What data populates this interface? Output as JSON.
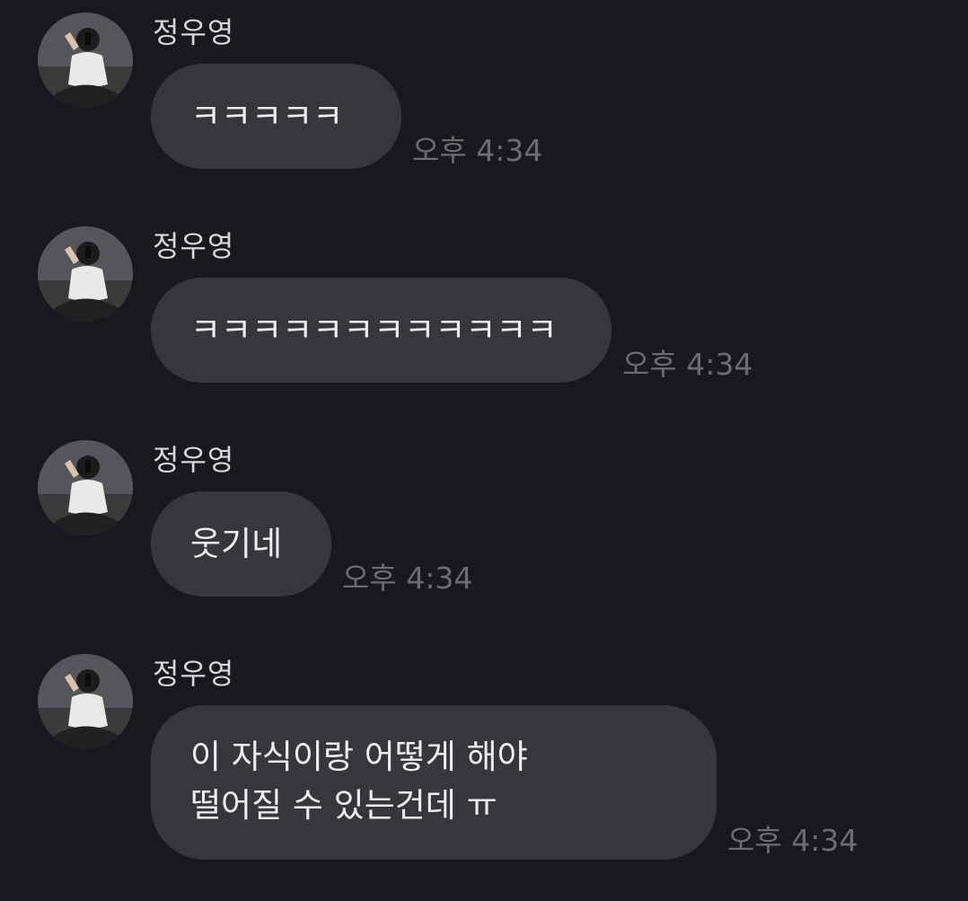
{
  "messages": [
    {
      "sender": "정우영",
      "text": "ㅋㅋㅋㅋㅋ",
      "time": "오후 4:34"
    },
    {
      "sender": "정우영",
      "text": "ㅋㅋㅋㅋㅋㅋㅋㅋㅋㅋㅋㅋ",
      "time": "오후 4:34"
    },
    {
      "sender": "정우영",
      "text": "웃기네",
      "time": "오후 4:34"
    },
    {
      "sender": "정우영",
      "text": "이 자식이랑 어떻게 해야\n떨어질 수 있는건데 ㅠ",
      "time": "오후 4:34"
    }
  ],
  "colors": {
    "background": "#18191d",
    "bubble": "#36373c",
    "bubble_text": "#eeeef0",
    "sender_text": "#d7d7d9",
    "time_text": "#6b6c71"
  },
  "icons": {
    "avatar": "profile-photo"
  }
}
